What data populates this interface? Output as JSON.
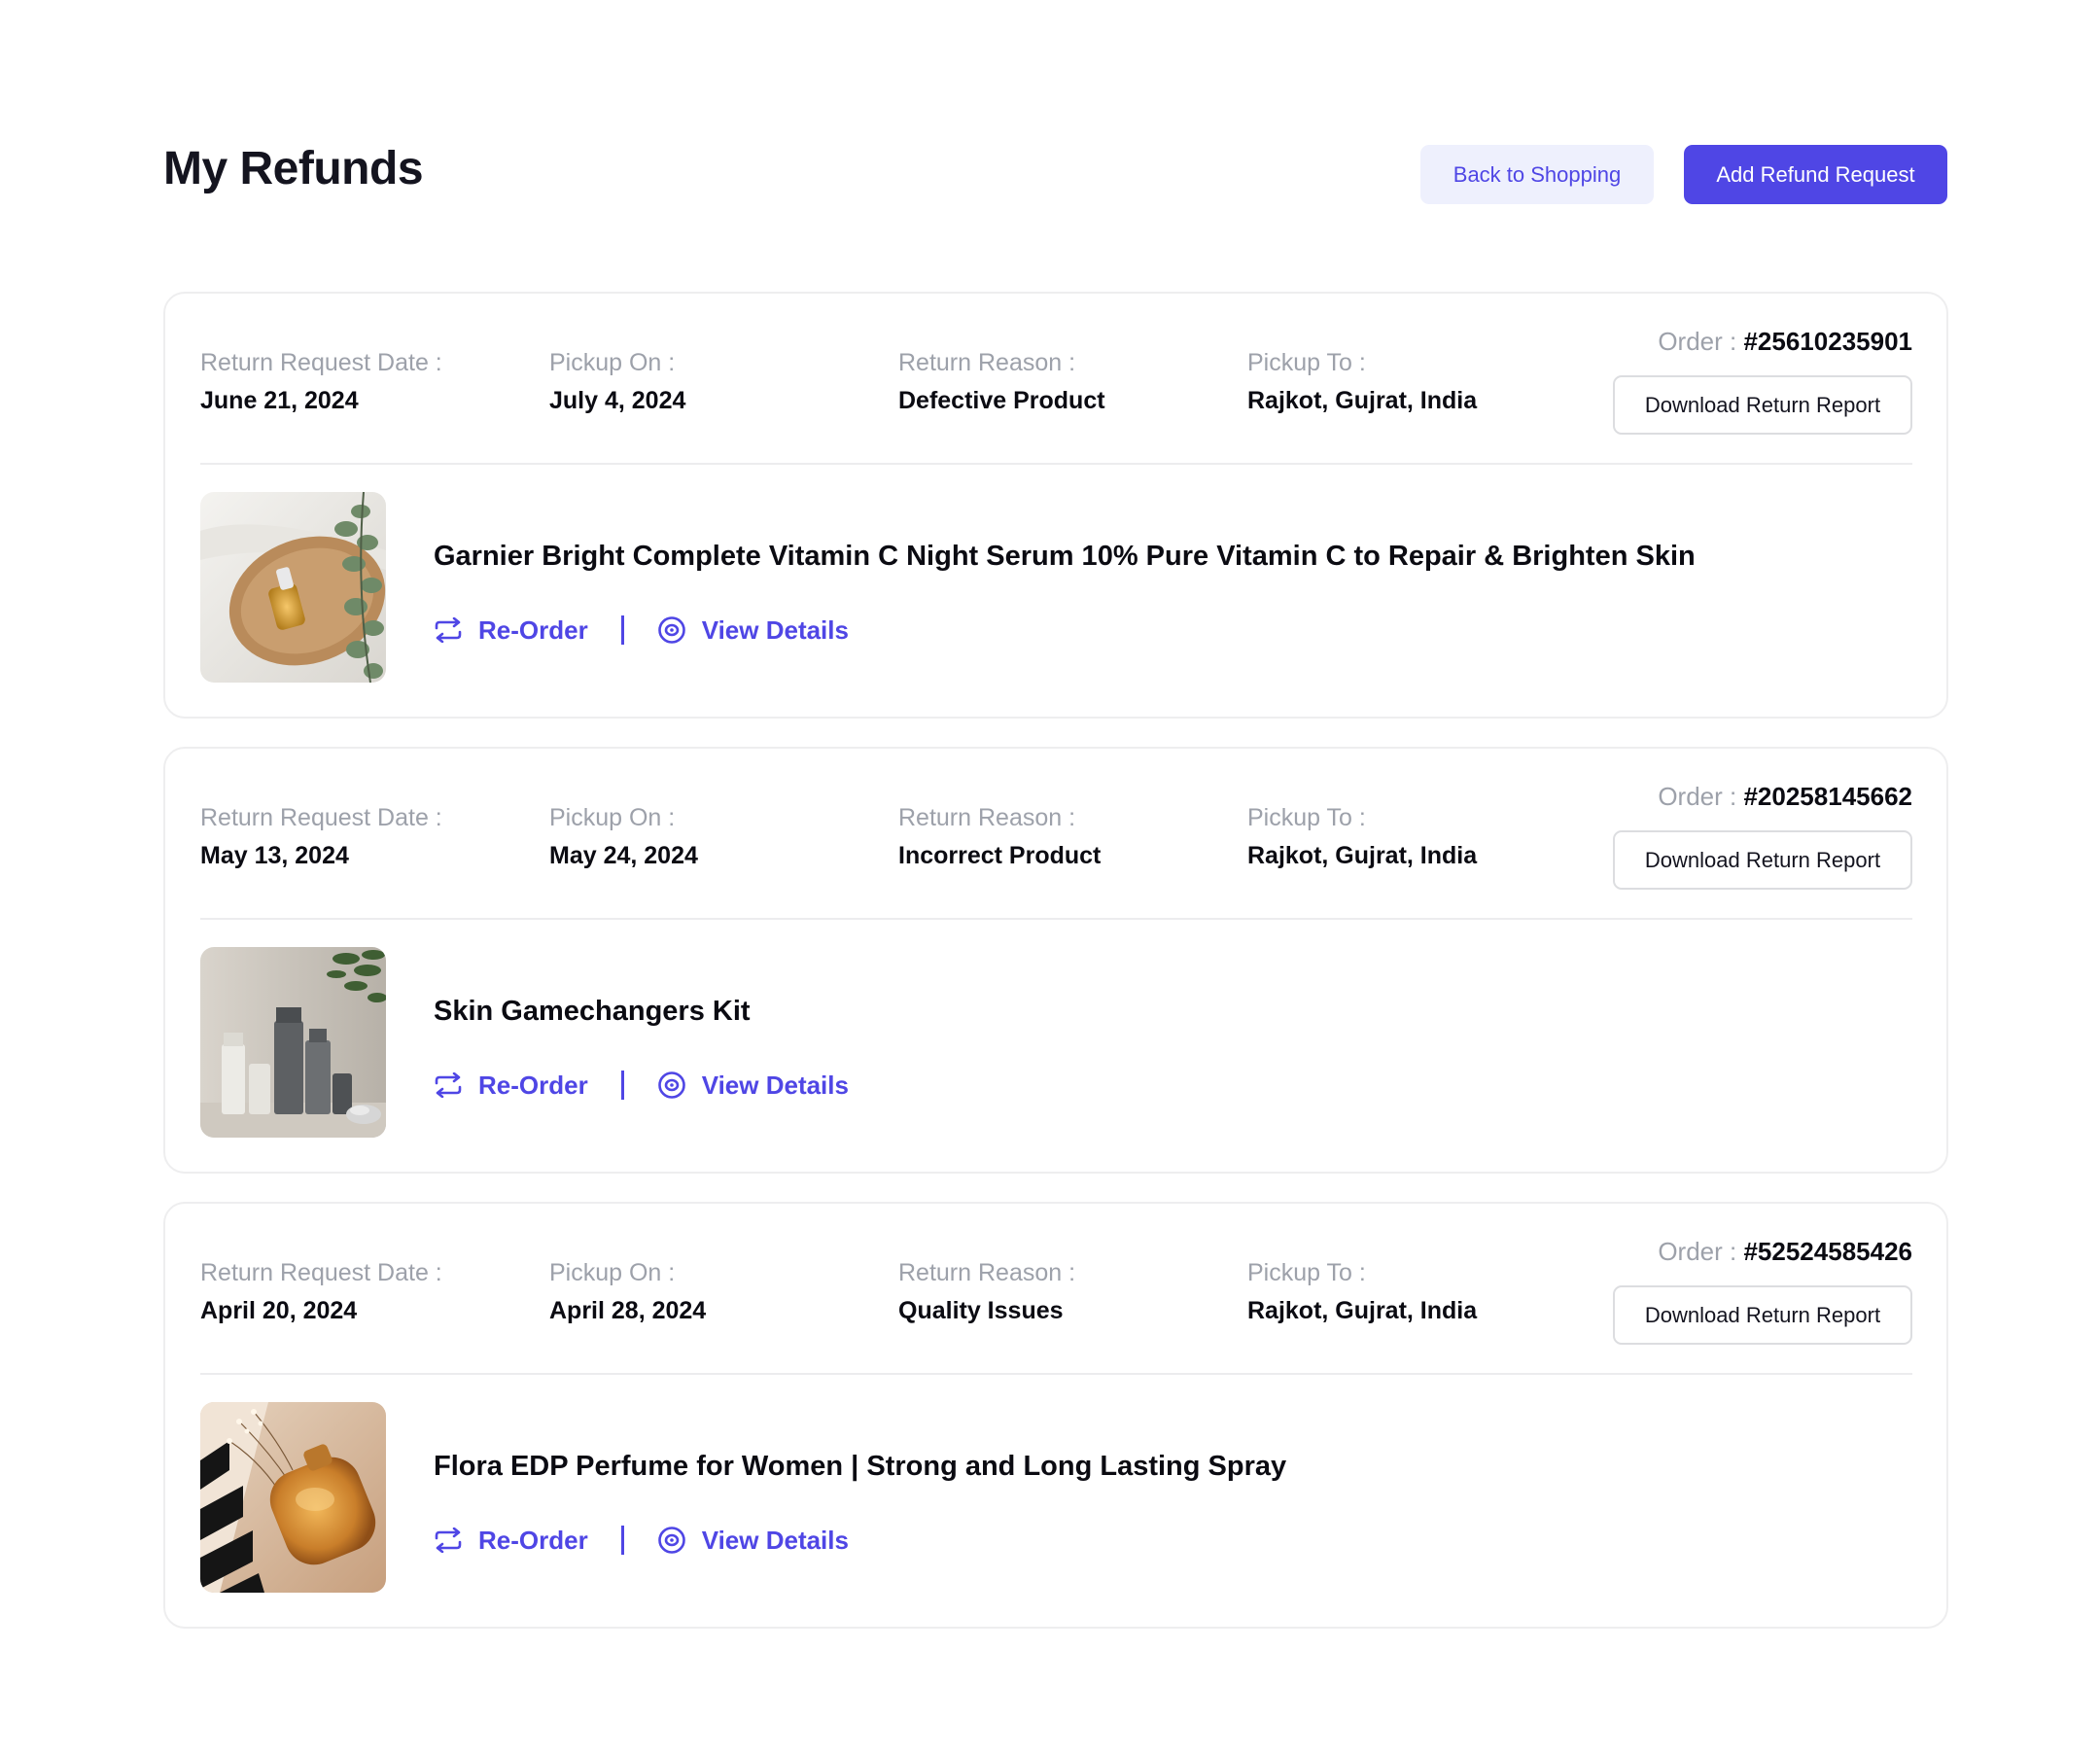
{
  "header": {
    "title": "My Refunds",
    "back_label": "Back to Shopping",
    "add_label": "Add Refund Request"
  },
  "labels": {
    "request_date": "Return Request Date :",
    "pickup_on": "Pickup On :",
    "reason": "Return Reason :",
    "pickup_to": "Pickup To :",
    "order": "Order :",
    "download": "Download Return Report",
    "reorder": "Re-Order",
    "view": "View Details"
  },
  "refunds": [
    {
      "request_date": "June 21, 2024",
      "pickup_on": "July 4, 2024",
      "reason": "Defective Product",
      "pickup_to": "Rajkot, Gujrat, India",
      "order_number": "#25610235901",
      "product_name": "Garnier Bright Complete Vitamin C Night Serum 10% Pure Vitamin C to Repair & Brighten Skin"
    },
    {
      "request_date": "May 13, 2024",
      "pickup_on": "May 24, 2024",
      "reason": "Incorrect Product",
      "pickup_to": "Rajkot, Gujrat, India",
      "order_number": "#20258145662",
      "product_name": "Skin Gamechangers Kit"
    },
    {
      "request_date": "April 20, 2024",
      "pickup_on": "April 28, 2024",
      "reason": "Quality Issues",
      "pickup_to": "Rajkot, Gujrat, India",
      "order_number": "#52524585426",
      "product_name": "Flora EDP Perfume for Women | Strong and Long Lasting Spray"
    }
  ],
  "colors": {
    "accent": "#4f46e5",
    "accent_soft": "#eef0fd",
    "muted_text": "#9da1aa",
    "border": "#eeeeef"
  }
}
